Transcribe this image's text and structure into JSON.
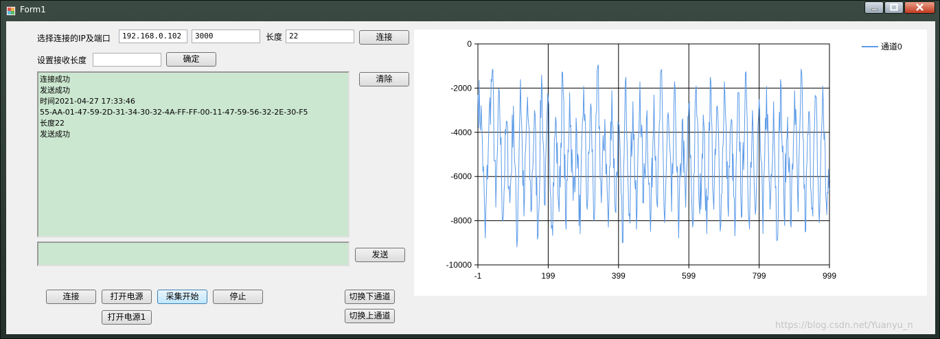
{
  "window": {
    "title": "Form1"
  },
  "connection": {
    "label": "选择连接的IP及端口",
    "ip": "192.168.0.102",
    "port": "3000",
    "length_label": "长度",
    "length_value": "22",
    "connect_button": "连接"
  },
  "receive": {
    "label": "设置接收长度",
    "value": "",
    "confirm_button": "确定"
  },
  "clear_button": "清除",
  "log": {
    "lines": [
      "连接成功",
      "发送成功",
      "时间2021-04-27 17:33:46",
      "55-AA-01-47-59-2D-31-34-30-32-4A-FF-FF-00-11-47-59-56-32-2E-30-F5",
      "长度22",
      "发送成功"
    ]
  },
  "send_input": {
    "value": ""
  },
  "send_button": "发送",
  "bottom_buttons": {
    "connect": "连接",
    "power_on": "打开电源",
    "start_capture": "采集开始",
    "stop": "停止",
    "power_on_1": "打开电源1",
    "next_channel": "切换下通道",
    "prev_channel": "切换上通道"
  },
  "watermark": "https://blog.csdn.net/Yuanyu_n",
  "chart_data": {
    "type": "line",
    "title": "",
    "xlabel": "",
    "ylabel": "",
    "xlim": [
      -1,
      999
    ],
    "ylim": [
      -10000,
      0
    ],
    "xticks": [
      "-1",
      "199",
      "399",
      "599",
      "799",
      "999"
    ],
    "yticks": [
      "0",
      "-2000",
      "-4000",
      "-6000",
      "-8000",
      "-10000"
    ],
    "grid": true,
    "legend_position": "top-right",
    "series": [
      {
        "name": "通道0",
        "color": "#5b9ae8",
        "x_start": -1,
        "x_end": 999,
        "envelope_note_free": true,
        "keypoints": [
          [
            -1,
            -2300
          ],
          [
            10,
            -3600
          ],
          [
            20,
            -8800
          ],
          [
            30,
            -3800
          ],
          [
            40,
            -1200
          ],
          [
            50,
            -7400
          ],
          [
            60,
            -2200
          ],
          [
            70,
            -8000
          ],
          [
            80,
            -3500
          ],
          [
            90,
            -7200
          ],
          [
            100,
            -2800
          ],
          [
            110,
            -9200
          ],
          [
            120,
            -1600
          ],
          [
            130,
            -7800
          ],
          [
            140,
            -2400
          ],
          [
            150,
            -7600
          ],
          [
            160,
            -3000
          ],
          [
            170,
            -8700
          ],
          [
            180,
            -1400
          ],
          [
            190,
            -7300
          ],
          [
            199,
            -2500
          ],
          [
            210,
            -8200
          ],
          [
            220,
            -3300
          ],
          [
            230,
            -7600
          ],
          [
            240,
            -1300
          ],
          [
            250,
            -8400
          ],
          [
            260,
            -2200
          ],
          [
            270,
            -7100
          ],
          [
            280,
            -3900
          ],
          [
            290,
            -8600
          ],
          [
            300,
            -1900
          ],
          [
            310,
            -7500
          ],
          [
            320,
            -2700
          ],
          [
            330,
            -8000
          ],
          [
            340,
            -1000
          ],
          [
            350,
            -7200
          ],
          [
            360,
            -3400
          ],
          [
            370,
            -8300
          ],
          [
            380,
            -2100
          ],
          [
            390,
            -7600
          ],
          [
            399,
            -3600
          ],
          [
            410,
            -9000
          ],
          [
            420,
            -1500
          ],
          [
            430,
            -7700
          ],
          [
            440,
            -2600
          ],
          [
            450,
            -8400
          ],
          [
            460,
            -1700
          ],
          [
            470,
            -7200
          ],
          [
            480,
            -3000
          ],
          [
            490,
            -8500
          ],
          [
            500,
            -2300
          ],
          [
            510,
            -7400
          ],
          [
            520,
            -1200
          ],
          [
            530,
            -8100
          ],
          [
            540,
            -3100
          ],
          [
            550,
            -7600
          ],
          [
            560,
            -2000
          ],
          [
            570,
            -8800
          ],
          [
            580,
            -3500
          ],
          [
            590,
            -7400
          ],
          [
            599,
            -2700
          ],
          [
            610,
            -8300
          ],
          [
            620,
            -1900
          ],
          [
            630,
            -7700
          ],
          [
            640,
            -3200
          ],
          [
            650,
            -8600
          ],
          [
            660,
            -1500
          ],
          [
            670,
            -7500
          ],
          [
            680,
            -2800
          ],
          [
            690,
            -8200
          ],
          [
            700,
            -1700
          ],
          [
            710,
            -7300
          ],
          [
            720,
            -3400
          ],
          [
            730,
            -8700
          ],
          [
            740,
            -2200
          ],
          [
            750,
            -7800
          ],
          [
            760,
            -1300
          ],
          [
            770,
            -8000
          ],
          [
            780,
            -3000
          ],
          [
            790,
            -7400
          ],
          [
            799,
            -2500
          ],
          [
            810,
            -8600
          ],
          [
            820,
            -1900
          ],
          [
            830,
            -7500
          ],
          [
            840,
            -2600
          ],
          [
            850,
            -8900
          ],
          [
            860,
            -1600
          ],
          [
            870,
            -7700
          ],
          [
            880,
            -3300
          ],
          [
            890,
            -8300
          ],
          [
            900,
            -2100
          ],
          [
            910,
            -7600
          ],
          [
            920,
            -1300
          ],
          [
            930,
            -8500
          ],
          [
            940,
            -3100
          ],
          [
            950,
            -7400
          ],
          [
            960,
            -2400
          ],
          [
            970,
            -8100
          ],
          [
            980,
            -1900
          ],
          [
            990,
            -7200
          ],
          [
            999,
            -6600
          ]
        ]
      }
    ]
  }
}
